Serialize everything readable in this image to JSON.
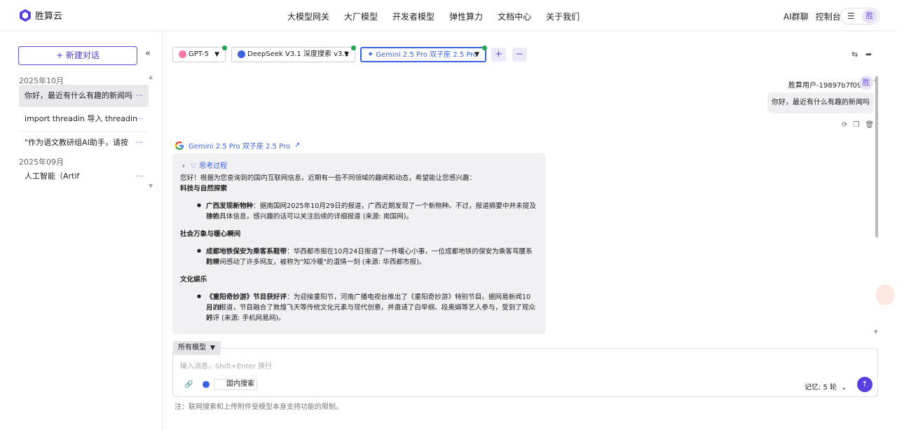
{
  "brand": {
    "name": "胜算云"
  },
  "nav": {
    "links": [
      "大模型网关",
      "大厂模型",
      "开发者模型",
      "弹性算力",
      "文档中心",
      "关于我们"
    ],
    "right": [
      "AI群聊",
      "控制台"
    ],
    "avatar_char": "胜"
  },
  "sidebar": {
    "new_chat": "+ 新建对话",
    "collapse_icon": "«",
    "groups": [
      {
        "date": "2025年10月",
        "items": [
          "你好，最近有什么有趣的新闻吗",
          "import threadin  导入 threadin",
          "\"作为语文教研组AI助手，请按"
        ]
      },
      {
        "date": "2025年09月",
        "items": [
          "人工智能（Artif"
        ]
      }
    ],
    "item_more": "···"
  },
  "models": {
    "tabs": [
      {
        "label": "GPT-5",
        "icon_color": "#f07aa8"
      },
      {
        "label": "DeepSeek V3.1   深度搜索 v3.1",
        "icon_color": "#3b63e0"
      },
      {
        "label": "Gemini 2.5 Pro   双子座 2.5 Pro",
        "icon_color": "#3b63e0"
      }
    ],
    "add": "+",
    "remove": "−"
  },
  "chat": {
    "user_name": "胜算用户-19897b7f095",
    "user_avatar": "胜",
    "user_message": "你好，最近有什么有趣的新闻吗",
    "bot_name": "Gemini 2.5 Pro   双子座 2.5 Pro",
    "thinking": "思考过程",
    "intro": "您好！根据为您查询到的国内互联网信息，近期有一些不同领域的趣闻和动态，希望能让您感兴趣：",
    "sections": [
      {
        "heading": "科技与自然探索",
        "bold": "广西发现新物种",
        "lines": [
          "：据南国网2025年10月29日的报道，广西近期发现了一个新物种。不过，报道摘要中并未提及该物",
          "种的具体信息，感兴趣的话可以关注后续的详细报道 (来源: 南国网)。"
        ]
      },
      {
        "heading": "社会万象与暖心瞬间",
        "bold": "成都地铁保安为乘客系鞋带",
        "lines": [
          "：华西都市报在10月24日报道了一件暖心小事，一位成都地铁的保安为乘客弯腰系鞋带",
          "的瞬间感动了许多网友，被称为\"知冷暖\"的温情一刻 (来源: 华西都市报)。"
        ]
      },
      {
        "heading": "文化娱乐",
        "bold": "《重阳奇妙游》节目获好评",
        "lines": [
          "：为迎接重阳节，河南广播电视台推出了《重阳奇妙游》特别节目。据网易新闻10月28",
          "日的报道，节目融合了敦煌飞天等传统文化元素与现代创意，并邀请了白举纲、段奥娟等艺人参与，受到了观众的",
          "好评 (来源: 手机网易网)。"
        ]
      }
    ]
  },
  "composer": {
    "model_filter": "所有模型",
    "placeholder": "输入消息，Shift+Enter 换行",
    "search_option": "国内搜索",
    "memory": "记忆:   5 轮",
    "send": "↑"
  },
  "footer_note": "注：联网搜索和上传附件受模型本身支持功能的限制。"
}
